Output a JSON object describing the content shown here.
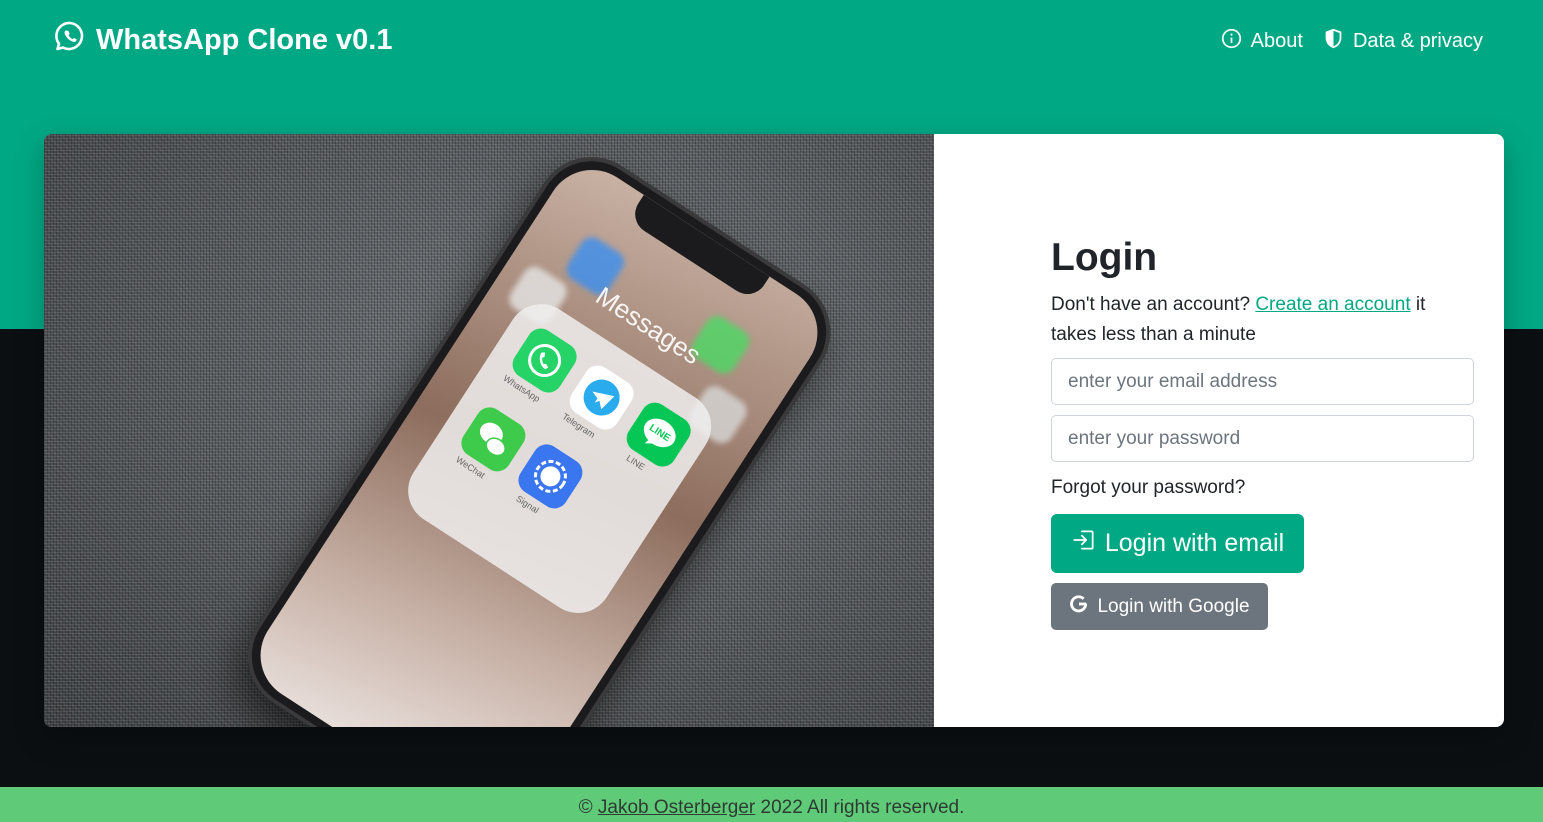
{
  "navbar": {
    "brand": "WhatsApp Clone v0.1",
    "brand_icon": "whatsapp-icon",
    "links": [
      {
        "label": "About",
        "icon": "info-circle-icon"
      },
      {
        "label": "Data & privacy",
        "icon": "shield-icon"
      }
    ]
  },
  "hero_image": {
    "folder_title": "Messages",
    "apps": [
      {
        "label": "WhatsApp",
        "color": "#25D366"
      },
      {
        "label": "Telegram",
        "color": "#2AABEE"
      },
      {
        "label": "WeChat",
        "color": "#3ecb4c"
      },
      {
        "label": "Signal",
        "color": "#3a76f0"
      },
      {
        "label": "LINE",
        "color": "#06c755"
      }
    ],
    "line_badge": "LINE"
  },
  "login": {
    "title": "Login",
    "signup_prefix": "Don't have an account?",
    "signup_link": "Create an account",
    "signup_suffix": "it takes less than a minute",
    "email_placeholder": "enter your email address",
    "password_placeholder": "enter your password",
    "forgot_label": "Forgot your password?",
    "email_button": "Login with email",
    "google_button": "Login with Google"
  },
  "footer": {
    "prefix": "©",
    "author": "Jakob Osterberger",
    "suffix": "2022 All rights reserved."
  },
  "colors": {
    "primary": "#00a884",
    "dark": "#0b0f12",
    "footer": "#5fcb78",
    "secondary_button": "#6c757d"
  }
}
